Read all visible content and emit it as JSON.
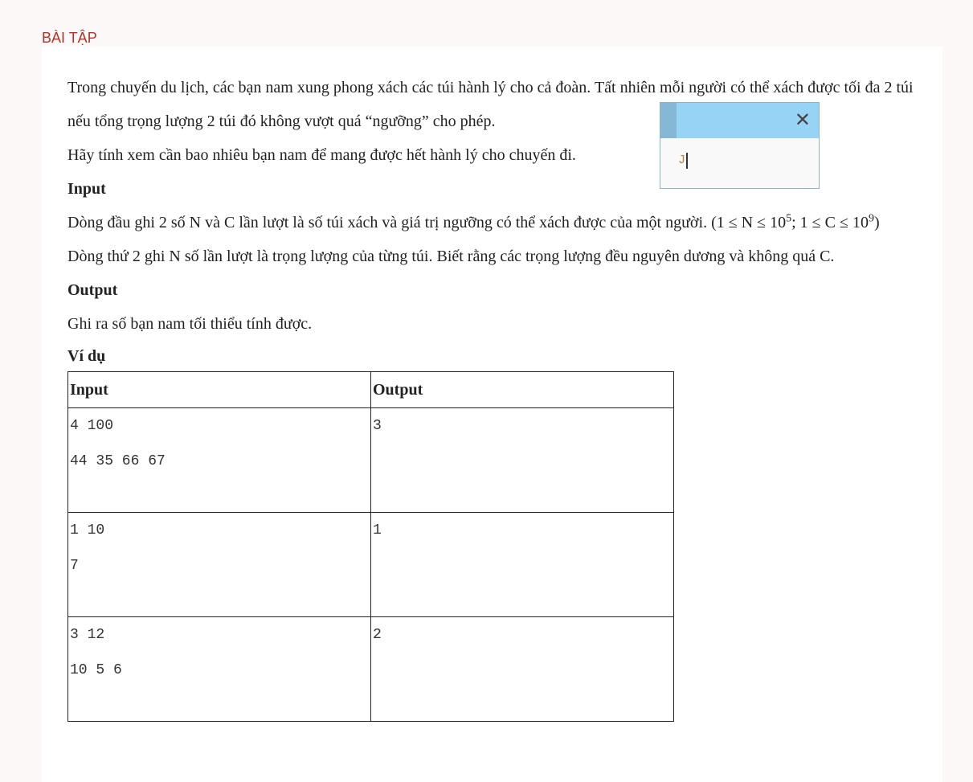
{
  "section_title": "BÀI TẬP",
  "problem": {
    "intro": [
      "Trong chuyến du lịch, các bạn nam xung phong xách các túi hành lý cho cả đoàn. Tất nhiên mỗi người có thể xách được tối đa 2 túi nếu tổng trọng lượng 2 túi đó không vượt quá “ngưỡng” cho phép.",
      "Hãy tính xem cần bao nhiêu bạn nam để mang được hết hành lý cho chuyến đi."
    ],
    "input_heading": "Input",
    "input_line1_a": "Dòng đầu ghi 2 số N và C lần lượt là số túi xách và giá trị ngưỡng có thể xách được của một người. (1 ≤ N ≤ 10",
    "input_line1_sup1": "5",
    "input_line1_b": "; 1 ≤ C ≤ 10",
    "input_line1_sup2": "9",
    "input_line1_c": ")",
    "input_line2": "Dòng thứ 2 ghi N số lần lượt là trọng lượng của từng túi. Biết rằng các trọng lượng đều nguyên dương và không quá C.",
    "output_heading": "Output",
    "output_line": "Ghi ra số bạn nam tối thiểu tính được.",
    "example_heading": "Ví dụ",
    "table": {
      "headers": [
        "Input",
        "Output"
      ],
      "rows": [
        {
          "input": [
            "4 100",
            "44 35 66 67"
          ],
          "output": "3"
        },
        {
          "input": [
            "1 10",
            "7"
          ],
          "output": "1"
        },
        {
          "input": [
            "3 12",
            "10 5 6"
          ],
          "output": "2"
        }
      ]
    }
  },
  "popup": {
    "close_icon": "close-icon",
    "input_value": "J"
  }
}
